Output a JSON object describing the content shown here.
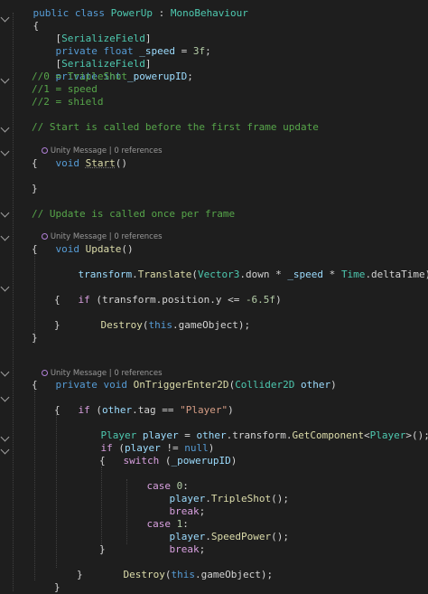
{
  "code": {
    "l0": {
      "a": "public class ",
      "b": "PowerUp",
      "c": " : ",
      "d": "MonoBehaviour"
    },
    "l1": {
      "a": "{"
    },
    "l2": {
      "a": "[",
      "b": "SerializeField",
      "c": "]"
    },
    "l3": {
      "a": "private float ",
      "b": "_speed",
      "c": " = ",
      "d": "3f",
      "e": ";"
    },
    "l4": {
      "a": "[",
      "b": "SerializeField",
      "c": "]"
    },
    "l5": {
      "a": "private int ",
      "b": "_powerupID",
      "c": ";"
    },
    "l6": {
      "a": "//0 = TripleShot"
    },
    "l7": {
      "a": "//1 = speed"
    },
    "l8": {
      "a": "//2 = shield"
    },
    "l9": {
      "a": "// Start is called before the first frame update"
    },
    "l10": {
      "a": "void ",
      "b": "Start",
      "c": "()"
    },
    "l11": {
      "a": "{"
    },
    "l12": {
      "a": "}"
    },
    "l13": {
      "a": "// Update is called once per frame"
    },
    "l14": {
      "a": "void ",
      "b": "Update",
      "c": "()"
    },
    "l15": {
      "a": "{"
    },
    "l16": {
      "a": "transform",
      "b": ".",
      "c": "Translate",
      "d": "(",
      "e": "Vector3",
      "f": ".down * ",
      "g": "_speed",
      "h": " * ",
      "i": "Time",
      "j": ".deltaTime);"
    },
    "l17": {
      "a": "if",
      " b": "",
      "c": " (transform.position.y <= ",
      "d": "-6.5f",
      "e": ")"
    },
    "l18": {
      "a": "{"
    },
    "l19": {
      "a": "Destroy",
      "b": "(",
      "c": "this",
      "d": ".gameObject);"
    },
    "l20": {
      "a": "}"
    },
    "l21": {
      "a": "}"
    },
    "l22": {
      "a": "private void ",
      "b": "OnTriggerEnter2D",
      "c": "(",
      "d": "Collider2D",
      "e": " ",
      "f": "other",
      "g": ")"
    },
    "l23": {
      "a": "{"
    },
    "l24": {
      "a": "if",
      " b": "",
      "c": " (",
      "d": "other",
      "e": ".tag == ",
      "f": "\"Player\"",
      "g": ")"
    },
    "l25": {
      "a": "{"
    },
    "l26": {
      "a": "Player",
      "b": " ",
      "c": "player",
      "d": " = ",
      "e": "other",
      "f": ".transform.",
      "g": "GetComponent",
      "h": "<",
      "i": "Player",
      "j": ">();"
    },
    "l27": {
      "a": "if",
      " b": "",
      "c": " (",
      "d": "player",
      "e": " != ",
      "f": "null",
      "g": ")"
    },
    "l28": {
      "a": "switch",
      " b": "",
      "c": " (",
      "d": "_powerupID",
      "e": ")"
    },
    "l29": {
      "a": "{"
    },
    "l30": {
      "a": "case ",
      "b": "0",
      "c": ":"
    },
    "l31": {
      "a": "player",
      "b": ".",
      "c": "TripleShot",
      "d": "();"
    },
    "l32": {
      "a": "break",
      "b": ";"
    },
    "l33": {
      "a": "case ",
      "b": "1",
      "c": ":"
    },
    "l34": {
      "a": "player",
      "b": ".",
      "c": "SpeedPower",
      "d": "();"
    },
    "l35": {
      "a": "break",
      "b": ";"
    },
    "l36": {
      "a": "}"
    },
    "l37": {
      "a": "Destroy",
      "b": "(",
      "c": "this",
      "d": ".gameObject);"
    },
    "l38": {
      "a": "}"
    },
    "l39": {
      "a": "}"
    }
  },
  "lens": {
    "start": {
      "kind": "Unity Message",
      "sep": " | ",
      "refs": "0 references"
    },
    "update": {
      "kind": "Unity Message",
      "sep": " | ",
      "refs": "0 references"
    },
    "trigger": {
      "kind": "Unity Message",
      "sep": " | ",
      "refs": "0 references"
    }
  },
  "colors": {
    "background": "#1e1e1e",
    "keyword": "#569cd6",
    "control": "#d8a0df",
    "type": "#4ec9b0",
    "method": "#dcdcaa",
    "variable": "#9cdcfe",
    "number": "#b5cea8",
    "string": "#d69d85",
    "comment": "#57a64a"
  },
  "icons": [
    "fold-arrow-icon",
    "unity-message-icon"
  ]
}
